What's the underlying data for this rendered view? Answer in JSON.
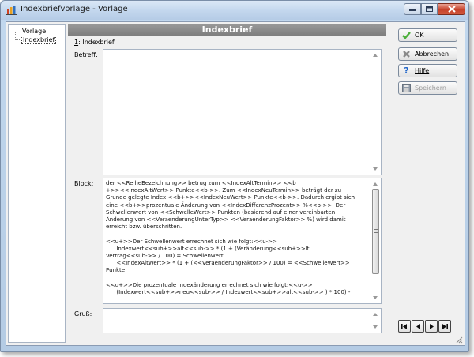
{
  "window": {
    "title": "Indexbriefvorlage - Vorlage",
    "accent": "#c6422b"
  },
  "tree": {
    "items": [
      {
        "label": "Vorlage"
      },
      {
        "label": "Indexbrief",
        "selected": true
      }
    ]
  },
  "form": {
    "header": "Indexbrief",
    "section_tab": {
      "mnemonic": "1",
      "label": ": Indexbrief"
    },
    "fields": {
      "betreff_label": "Betreff:",
      "betreff_value": "",
      "block_label": "Block:",
      "block_value": "der <<ReiheBezeichnung>> betrug zum <<IndexAltTermin>> <<b\n+>><<IndexAltWert>> Punkte<<b->>. Zum <<IndexNeuTermin>> beträgt der zu\nGrunde gelegte Index <<b+>><<IndexNeuWert>> Punkte<<b->>. Dadurch ergibt sich\neine <<b+>>prozentuale Änderung von <<IndexDifferenzProzent>> %<<b->>. Der\nSchwellenwert von <<SchwelleWert>> Punkten (basierend auf einer vereinbarten\nÄnderung von <<VeraenderungUnterTyp>> <<VeraenderungFaktor>> %) wird damit\nerreicht bzw. überschritten.\n\n<<u+>>Der Schwellenwert errechnet sich wie folgt:<<u->>\n      Indexwert<<sub+>>alt<<sub->> * (1 + (Veränderung<<sub+>>lt.\nVertrag<<sub->> / 100) = Schwellenwert\n      <<IndexAltWert>> * (1 + (<<VeraenderungFaktor>> / 100) = <<SchwelleWert>>\nPunkte\n\n<<u+>>Die prozentuale Indexänderung errechnet sich wie folgt:<<u->>\n      (Indexwert<<sub+>>neu<<sub->> / Indexwert<<sub+>>alt<<sub->> ) * 100) -",
      "gruss_label": "Gruß:",
      "gruss_value": ""
    }
  },
  "buttons": {
    "ok": {
      "label": "OK",
      "icon": "check-icon",
      "color": "#4caf3a"
    },
    "abbrechen": {
      "label": "Abbrechen",
      "icon": "cancel-x-icon"
    },
    "hilfe": {
      "label": "Hilfe",
      "icon": "help-question-icon",
      "color": "#1b62c8"
    },
    "speichern": {
      "label": "Speichern",
      "icon": "floppy-disk-icon",
      "disabled": true
    }
  },
  "navigation": {
    "icons": [
      "first-record-icon",
      "previous-record-icon",
      "next-record-icon",
      "last-record-icon"
    ]
  }
}
